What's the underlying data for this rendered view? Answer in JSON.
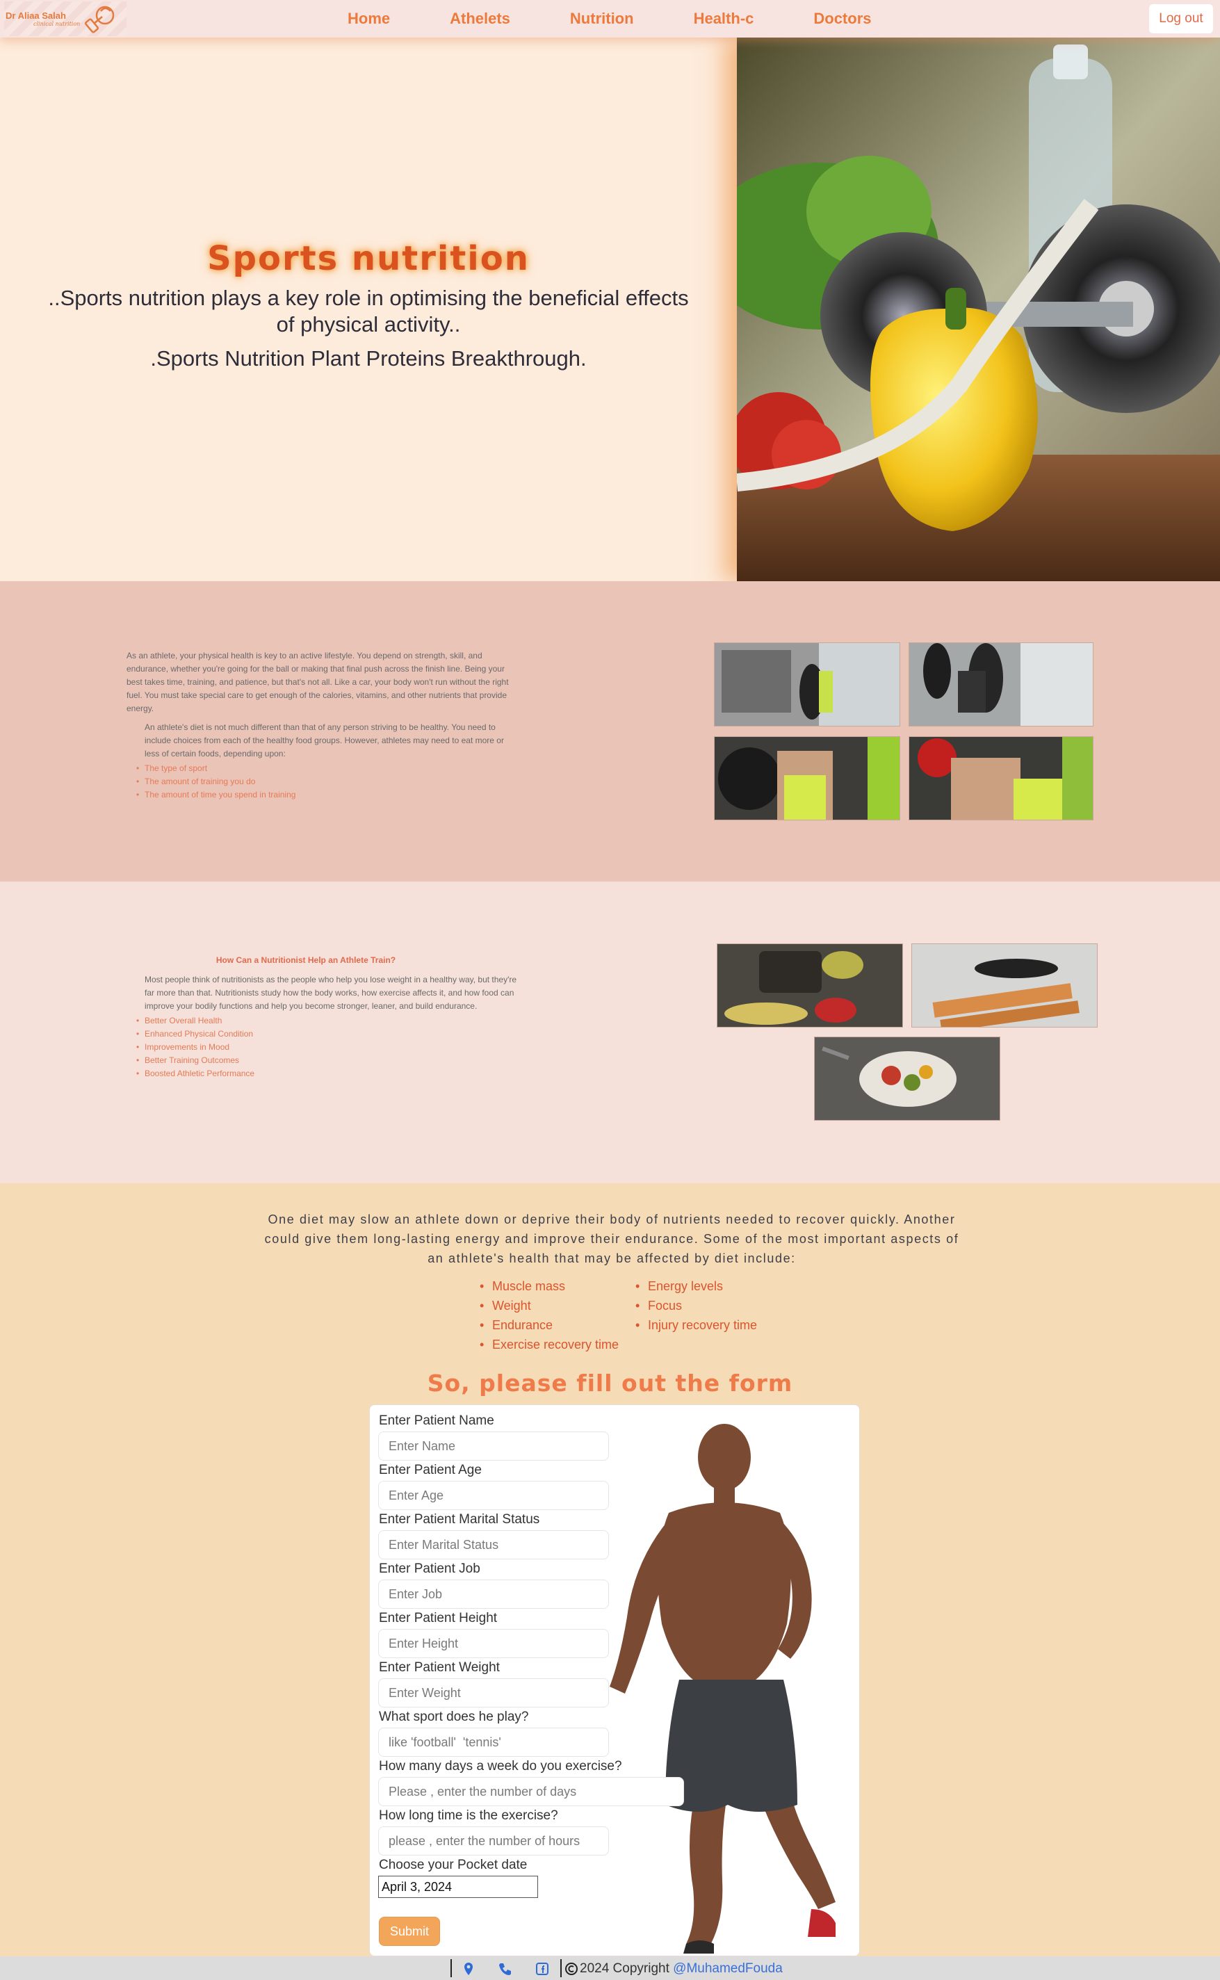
{
  "brand": {
    "name": "Dr Aliaa Salah",
    "subtitle": "clinical nutrition"
  },
  "nav": {
    "links": [
      "Home",
      "Athelets",
      "Nutrition",
      "Health-c",
      "Doctors"
    ],
    "logout": "Log out"
  },
  "hero": {
    "title": "Sports nutrition",
    "line1": "..Sports nutrition plays a key role in optimising the beneficial effects of physical activity..",
    "line2": ".Sports Nutrition Plant Proteins Breakthrough."
  },
  "section2": {
    "p1": "As an athlete, your physical health is key to an active lifestyle. You depend on strength, skill, and endurance, whether you're going for the ball or making that final push across the finish line. Being your best takes time, training, and patience, but that's not all. Like a car, your body won't run without the right fuel. You must take special care to get enough of the calories, vitamins, and other nutrients that provide energy.",
    "p2": "An athlete's diet is not much different than that of any person striving to be healthy. You need to include choices from each of the healthy food groups. However, athletes may need to eat more or less of certain foods, depending upon:",
    "items": [
      "The type of sport",
      "The amount of training you do",
      "The amount of time you spend in training"
    ]
  },
  "section3": {
    "heading": "How Can a Nutritionist Help an Athlete Train?",
    "p1": "Most people think of nutritionists as the people who help you lose weight in a healthy way, but they're far more than that. Nutritionists study how the body works, how exercise affects it, and how food can improve your bodily functions and help you become stronger, leaner, and build endurance.",
    "items": [
      "Better Overall Health",
      "Enhanced Physical Condition",
      "Improvements in Mood",
      "Better Training Outcomes",
      "Boosted Athletic Performance"
    ]
  },
  "section4": {
    "paragraph": "One diet may slow an athlete down or deprive their body of nutrients needed to recover quickly. Another could give them long-lasting energy and improve their endurance. Some of the most important aspects of an athlete's health that may be affected by diet include:",
    "col1": [
      "Muscle mass",
      "Weight",
      "Endurance",
      "Exercise recovery time"
    ],
    "col2": [
      "Energy levels",
      "Focus",
      "Injury recovery time"
    ],
    "form_heading": "So, please fill out the form"
  },
  "form": {
    "fields": [
      {
        "label": "Enter Patient Name",
        "placeholder": "Enter Name"
      },
      {
        "label": "Enter Patient Age",
        "placeholder": "Enter Age"
      },
      {
        "label": "Enter Patient Marital Status",
        "placeholder": "Enter Marital Status"
      },
      {
        "label": "Enter Patient Job",
        "placeholder": "Enter Job"
      },
      {
        "label": "Enter Patient Height",
        "placeholder": "Enter Height"
      },
      {
        "label": "Enter Patient Weight",
        "placeholder": "Enter Weight"
      },
      {
        "label": "What sport does he play?",
        "placeholder": "like 'football'  'tennis'"
      },
      {
        "label": "How many days a week do you exercise?",
        "placeholder": "Please , enter the number of days"
      },
      {
        "label": "How long time is the exercise?",
        "placeholder": "please , enter the number of hours"
      }
    ],
    "date_label": "Choose your Pocket date",
    "date_value": "April 3, 2024",
    "submit": "Submit"
  },
  "footer": {
    "copyright": "2024 Copyright",
    "handle": "@MuhamedFouda"
  },
  "colors": {
    "accent": "#ec7a3c",
    "hero_title": "#d9521f",
    "list": "#e57a56",
    "submit": "#f3a65a"
  },
  "icons": [
    "dumbbell-icon",
    "location-pin-icon",
    "phone-icon",
    "facebook-icon",
    "copyright-icon"
  ]
}
